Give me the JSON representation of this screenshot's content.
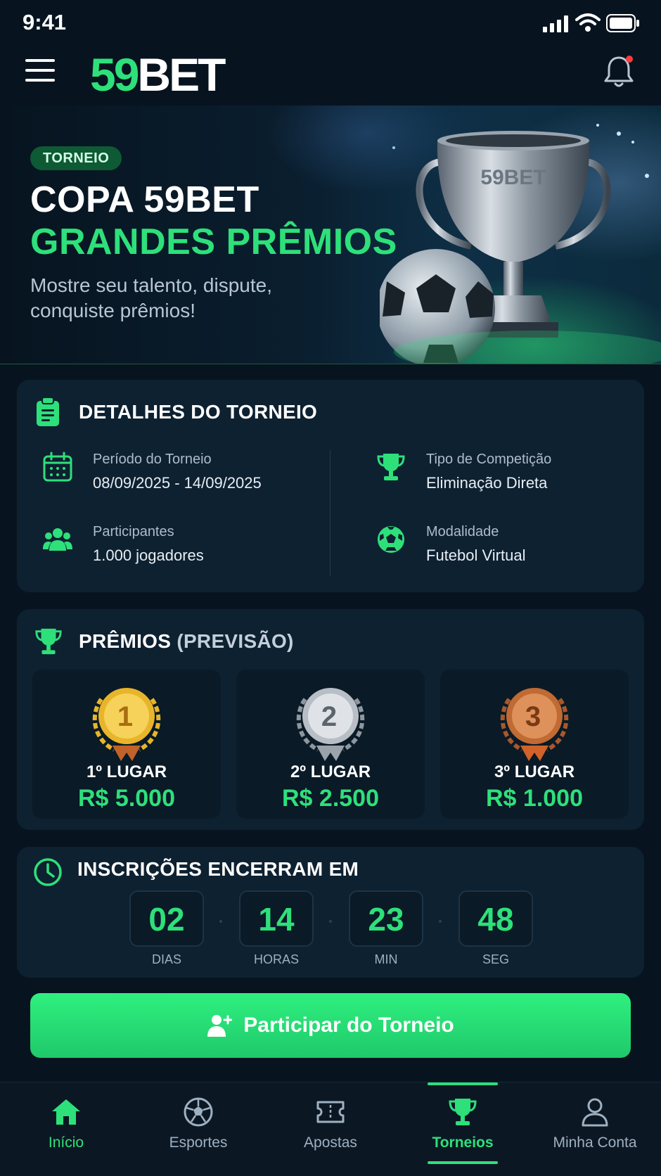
{
  "status_bar": {
    "time": "9:41"
  },
  "header": {
    "logo_number": "59",
    "logo_text": "BET"
  },
  "hero": {
    "badge": "TORNEIO",
    "title_line1": "COPA 59BET",
    "title_line2": "GRANDES PRÊMIOS",
    "subtitle": "Mostre seu talento, dispute, conquiste prêmios!",
    "trophy_engraving": "59BET"
  },
  "details": {
    "title": "DETALHES DO TORNEIO",
    "items": [
      {
        "label": "Período do Torneio",
        "value": "08/09/2025 - 14/09/2025",
        "icon": "calendar-icon"
      },
      {
        "label": "Tipo de Competição",
        "value": "Eliminação Direta",
        "icon": "trophy-icon"
      },
      {
        "label": "Participantes",
        "value": "1.000 jogadores",
        "icon": "users-icon"
      },
      {
        "label": "Modalidade",
        "value": "Futebol Virtual",
        "icon": "soccer-ball-icon"
      }
    ]
  },
  "prizes": {
    "title": "PRÊMIOS",
    "title_suffix": "(PREVISÃO)",
    "items": [
      {
        "rank": "1",
        "place": "1º LUGAR",
        "amount": "R$ 5.000",
        "medal_color": "#e8b52a"
      },
      {
        "rank": "2",
        "place": "2º LUGAR",
        "amount": "R$ 2.500",
        "medal_color": "#b8bec6"
      },
      {
        "rank": "3",
        "place": "3º LUGAR",
        "amount": "R$ 1.000",
        "medal_color": "#c06a34"
      }
    ]
  },
  "countdown": {
    "title": "INSCRIÇÕES ENCERRAM EM",
    "units": [
      {
        "value": "02",
        "label": "DIAS"
      },
      {
        "value": "14",
        "label": "HORAS"
      },
      {
        "value": "23",
        "label": "MIN"
      },
      {
        "value": "48",
        "label": "SEG"
      }
    ]
  },
  "cta": {
    "label": "Participar do Torneio"
  },
  "bottom_nav": {
    "items": [
      {
        "label": "Início",
        "icon": "home-icon",
        "active": false
      },
      {
        "label": "Esportes",
        "icon": "soccer-ball-icon",
        "active": false
      },
      {
        "label": "Apostas",
        "icon": "ticket-icon",
        "active": false
      },
      {
        "label": "Torneios",
        "icon": "trophy-icon",
        "active": true
      },
      {
        "label": "Minha Conta",
        "icon": "user-icon",
        "active": false
      }
    ]
  },
  "colors": {
    "accent": "#2ee07a",
    "background": "#071420",
    "card": "#0e2131"
  }
}
